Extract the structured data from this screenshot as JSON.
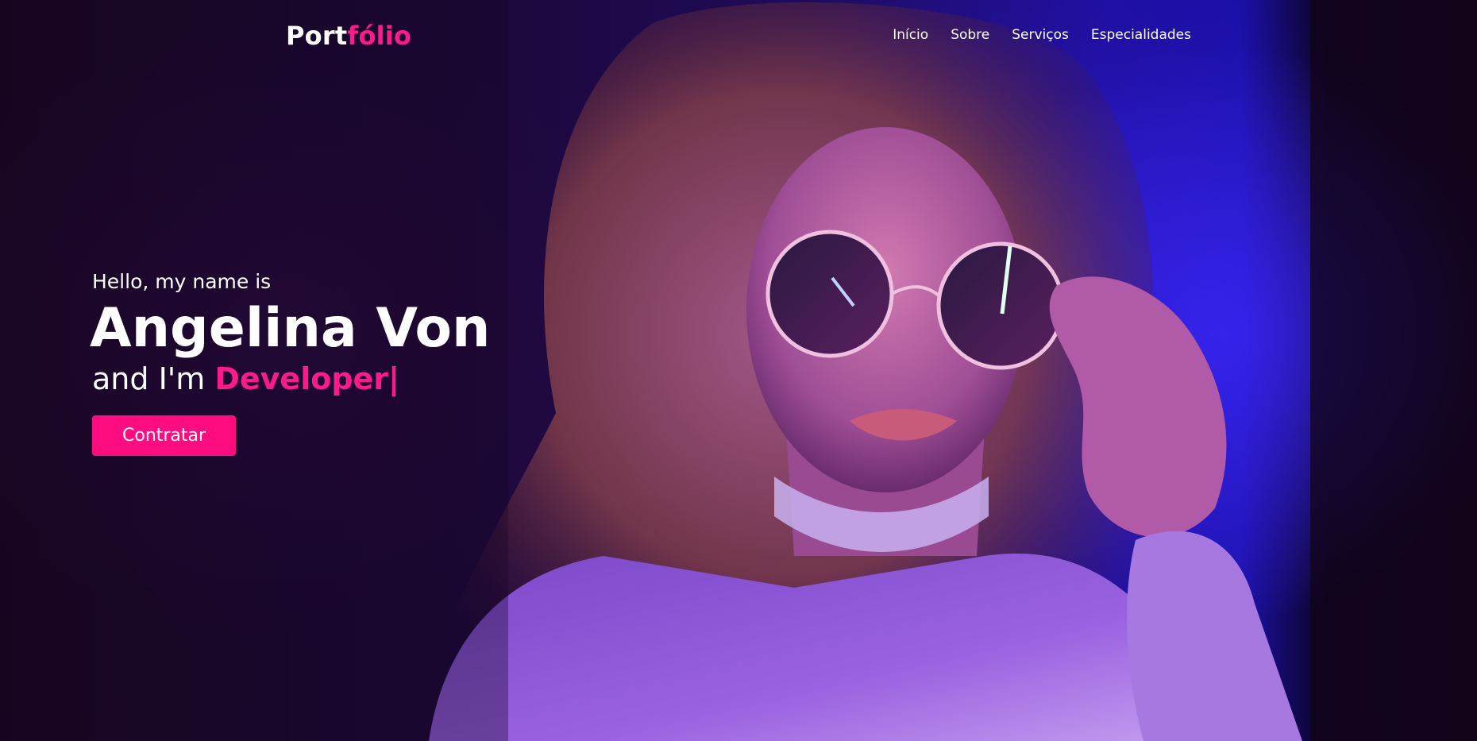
{
  "header": {
    "logo_main": "Port",
    "logo_accent": "fólio",
    "nav": [
      {
        "label": "Início"
      },
      {
        "label": "Sobre"
      },
      {
        "label": "Serviços"
      },
      {
        "label": "Especialidades"
      }
    ]
  },
  "hero": {
    "greeting": "Hello, my name is",
    "name": "Angelina Von",
    "role_prefix": "and I'm",
    "role": "Developer",
    "cursor": "|",
    "cta_label": "Contratar"
  },
  "colors": {
    "accent": "#ff1a8c",
    "button": "#ff0d80",
    "text": "#ffffff",
    "background": "#1a0830"
  }
}
